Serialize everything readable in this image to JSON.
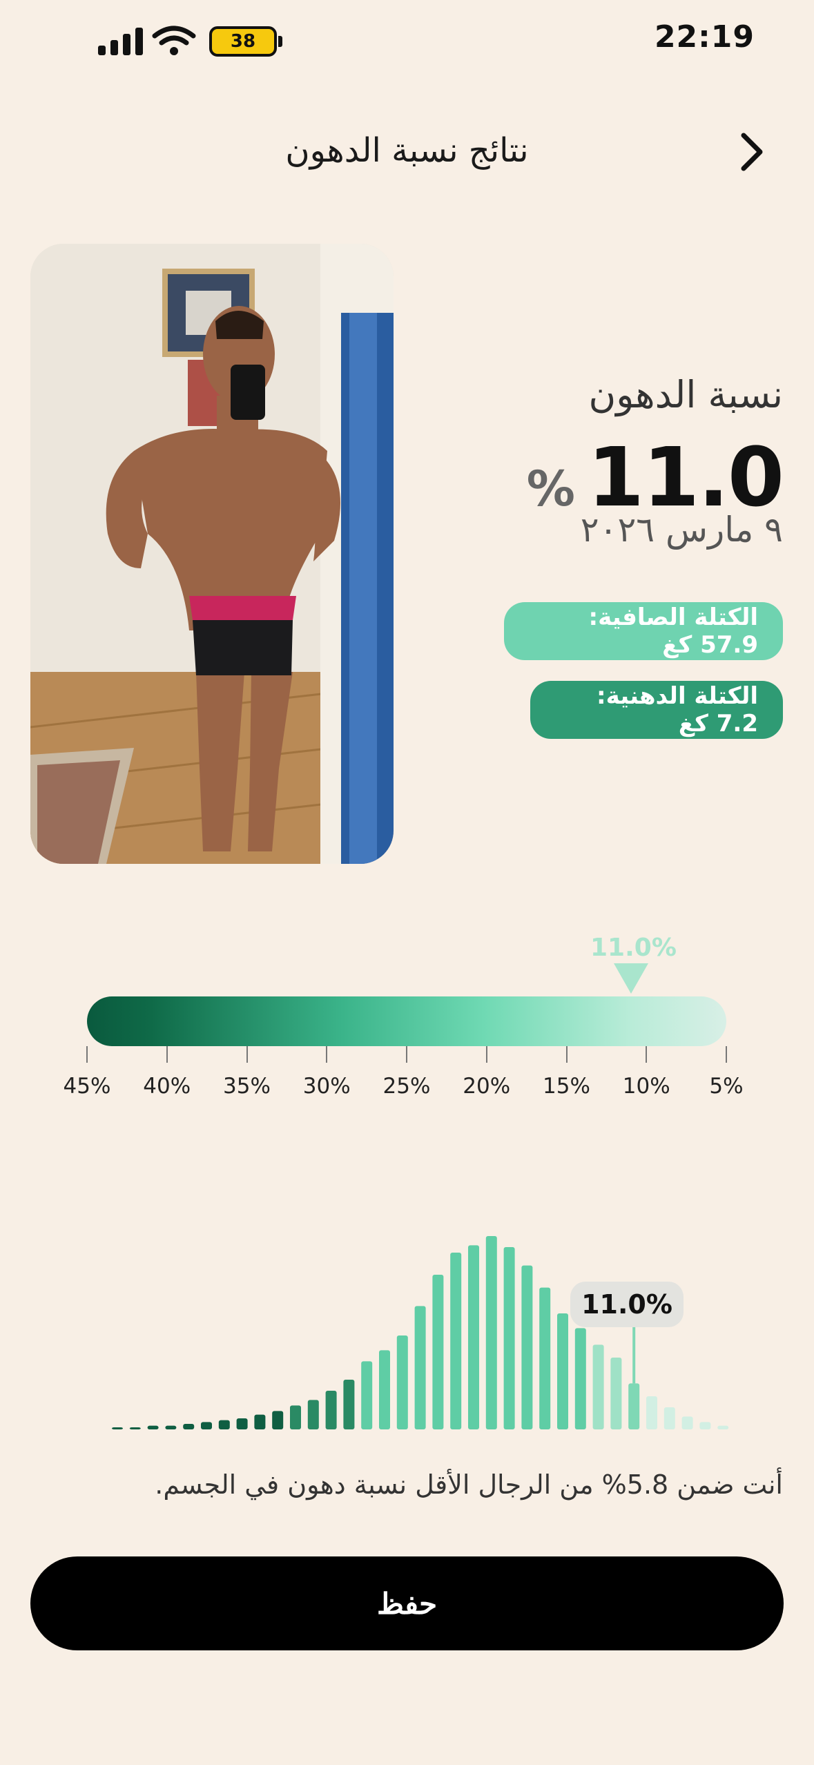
{
  "status_bar": {
    "time": "22:19",
    "battery": "38"
  },
  "header": {
    "title": "نتائج نسبة الدهون"
  },
  "stats": {
    "label": "نسبة الدهون",
    "value": "11.0",
    "unit": "%",
    "date": "٩ مارس ٢٠٢٦",
    "lean_mass": "الكتلة الصافية: 57.9 كغ",
    "fat_mass": "الكتلة الدهنية: 7.2 كغ"
  },
  "scale": {
    "marker_label": "11.0%",
    "marker_value": 11.0,
    "ticks": [
      "45%",
      "40%",
      "35%",
      "30%",
      "25%",
      "20%",
      "15%",
      "10%",
      "5%"
    ]
  },
  "histogram": {
    "tooltip": "11.0%",
    "highlight_index": 29,
    "values": [
      1,
      1,
      2,
      2,
      3,
      4,
      5,
      6,
      8,
      10,
      13,
      16,
      21,
      27,
      37,
      43,
      51,
      67,
      84,
      96,
      100,
      105,
      99,
      89,
      77,
      63,
      55,
      46,
      39,
      25,
      18,
      12,
      7,
      4,
      2
    ]
  },
  "percentile_text": "أنت ضمن 5.8% من الرجال الأقل نسبة دهون في الجسم.",
  "save_button": "حفظ",
  "colors": {
    "background": "#f8efe5",
    "primary_green": "#2f9b74",
    "light_green": "#6fd3b0",
    "button": "#000000"
  }
}
